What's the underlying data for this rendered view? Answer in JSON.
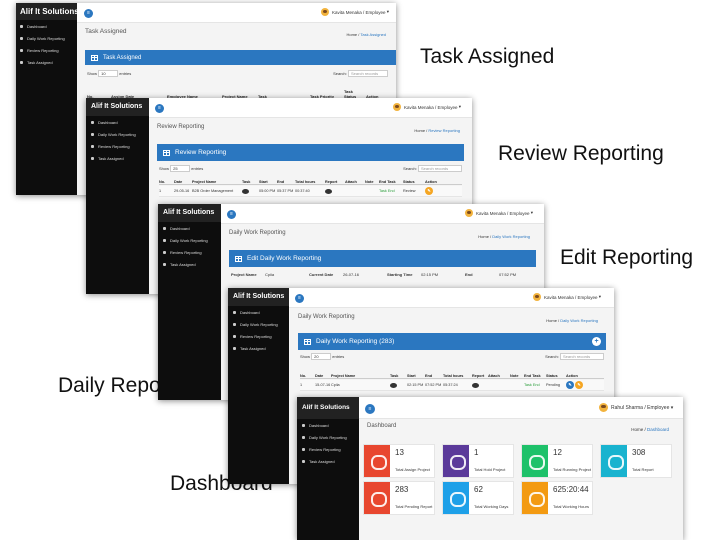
{
  "captions": {
    "task": "Task Assigned",
    "review": "Review Reporting",
    "edit": "Edit Reporting",
    "daily": "Daily Reporting",
    "dashboard": "Dashboard"
  },
  "sidebar": {
    "brand": "Alif It Solutions",
    "items": [
      "Dashboard",
      "Daily Work Reporting",
      "Review Reporting",
      "Task Assigned"
    ]
  },
  "user_kavita": "Kavita Menaka / Employee",
  "user_rahul": "Rahul Sharma / Employee",
  "home": "Home /",
  "task": {
    "title": "Task Assigned",
    "panel": "Task Assigned",
    "show": "Show",
    "entries_value": "10",
    "entries": "entries",
    "search": "Search:",
    "search_placeholder": "Search records",
    "columns": [
      "No.",
      "Assign Date",
      "Employee Name",
      "Project Name",
      "Task",
      "Task Priority",
      "Task Status",
      "Action"
    ]
  },
  "review": {
    "title": "Review Reporting",
    "panel": "Review Reporting",
    "show": "Show",
    "entries_value": "25",
    "entries": "entries",
    "search": "Search:",
    "search_placeholder": "Search records",
    "columns": [
      "No.",
      "Date",
      "Project Name",
      "Task",
      "Start",
      "End",
      "Total hours",
      "Report",
      "Attach",
      "Note",
      "End Task",
      "Status",
      "Action"
    ],
    "row": [
      "1",
      "29-05-16",
      "B2B Order Management",
      "",
      "05:00 PM",
      "05:37 PM",
      "00:37:40",
      "",
      "",
      "",
      "Task End",
      "Review",
      ""
    ]
  },
  "edit": {
    "title": "Daily Work Reporting",
    "panel": "Edit Daily Work Reporting",
    "project_label": "Project Name",
    "project_value": "Cpiia",
    "date_label": "Current Date",
    "date_value": "26-07-16",
    "start_label": "Starting Time",
    "start_value": "02:15 PM",
    "end_label": "End",
    "end_value": "07:52 PM"
  },
  "daily": {
    "title": "Daily Work Reporting",
    "panel": "Daily Work Reporting (283)",
    "show": "Show",
    "entries_value": "20",
    "entries": "entries",
    "search": "Search:",
    "search_placeholder": "Search records",
    "columns": [
      "No.",
      "Date",
      "Project Name",
      "Task",
      "Start",
      "End",
      "Total hours",
      "Report",
      "Attach",
      "Note",
      "End Task",
      "Status",
      "Action"
    ],
    "row": [
      "1",
      "15-07-16",
      "Cpiia",
      "",
      "02:15 PM",
      "07:52 PM",
      "05:37:24",
      "",
      "",
      "",
      "Task End",
      "Pending",
      ""
    ]
  },
  "dash": {
    "title": "Dashboard",
    "tiles": [
      {
        "value": "13",
        "label": "Total Assign Project",
        "color": "#e8472f"
      },
      {
        "value": "1",
        "label": "Total Hold Project",
        "color": "#5b3a9a"
      },
      {
        "value": "12",
        "label": "Total Running Project",
        "color": "#1ec16a"
      },
      {
        "value": "308",
        "label": "Total Report",
        "color": "#19b3cf"
      },
      {
        "value": "283",
        "label": "Total Pending Report",
        "color": "#e8472f"
      },
      {
        "value": "62",
        "label": "Total Working Days",
        "color": "#1ea0e8"
      },
      {
        "value": "625:20:44",
        "label": "Total Working Hours",
        "color": "#f39a12"
      }
    ]
  }
}
